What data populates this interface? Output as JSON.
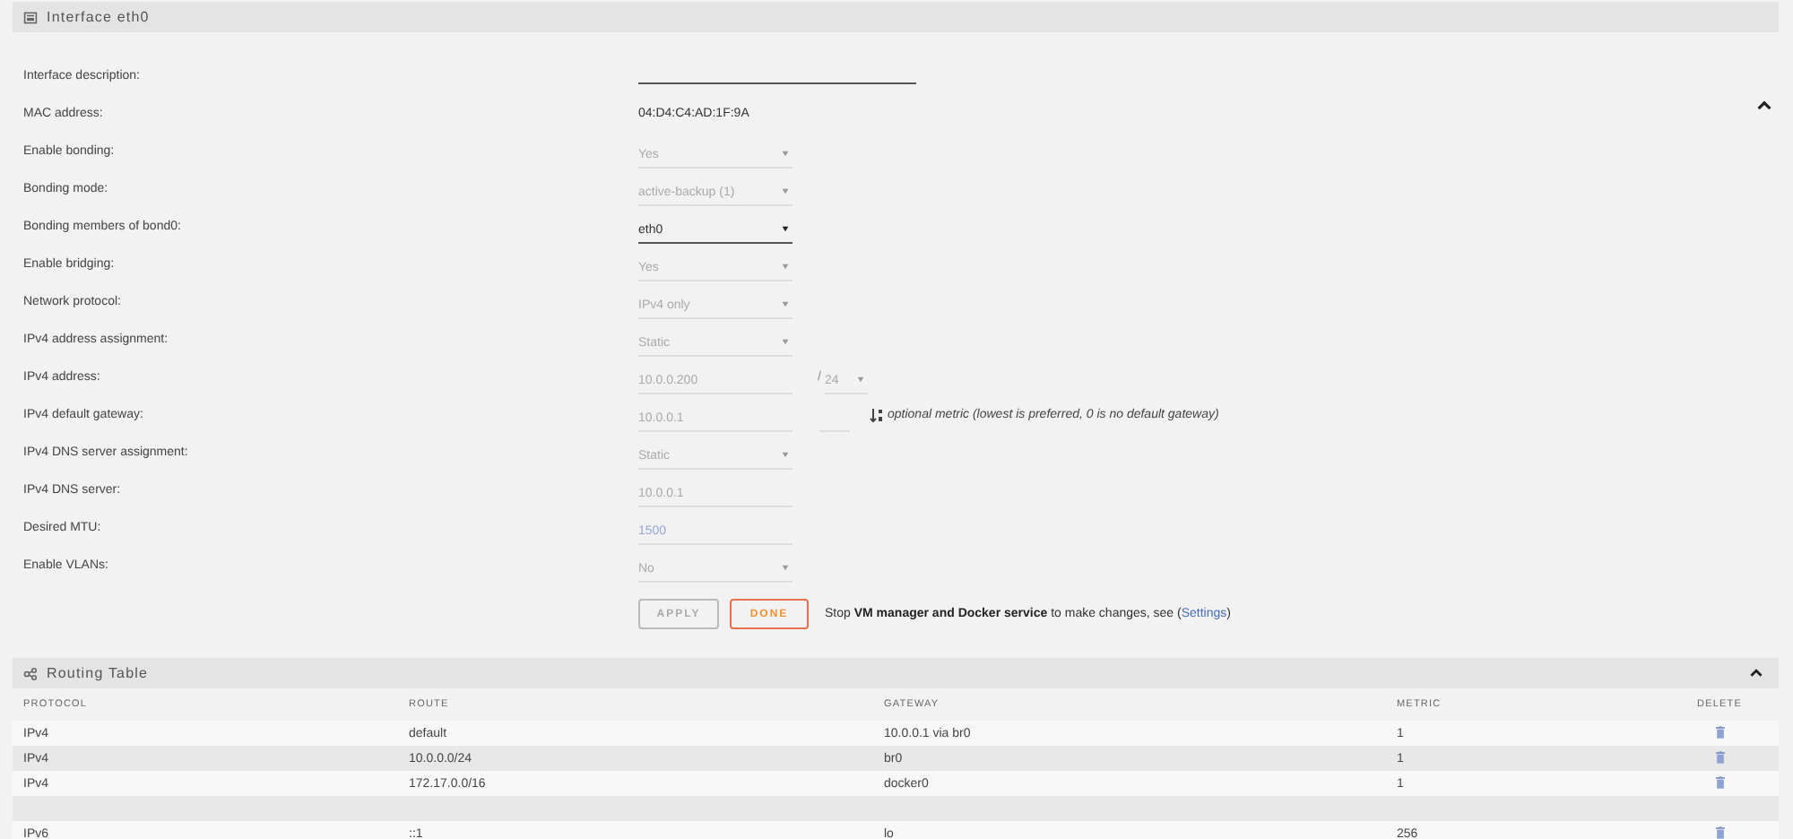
{
  "interface_panel": {
    "title": "Interface eth0",
    "expanded": true,
    "rows": [
      {
        "label": "Interface description:",
        "field": {
          "kind": "input",
          "disabled": false
        }
      },
      {
        "label": "MAC address:",
        "field": {
          "kind": "static",
          "value": "04:D4:C4:AD:1F:9A"
        }
      },
      {
        "label": "Enable bonding:",
        "field": {
          "kind": "select",
          "value": "Yes",
          "disabled": true
        }
      },
      {
        "label": "Bonding mode:",
        "field": {
          "kind": "select",
          "value": "active-backup (1)",
          "disabled": true
        }
      },
      {
        "label": "Bonding members of bond0:",
        "field": {
          "kind": "select",
          "value": "eth0",
          "disabled": false
        }
      },
      {
        "label": "Enable bridging:",
        "field": {
          "kind": "select",
          "value": "Yes",
          "disabled": true
        }
      },
      {
        "label": "Network protocol:",
        "field": {
          "kind": "select",
          "value": "IPv4 only",
          "disabled": true
        }
      },
      {
        "label": "IPv4 address assignment:",
        "field": {
          "kind": "select",
          "value": "Static",
          "disabled": true
        }
      },
      {
        "label": "IPv4 address:",
        "field": {
          "kind": "input",
          "value": "10.0.0.200",
          "disabled": true
        },
        "netmask": {
          "separator": "/",
          "value": "24"
        }
      },
      {
        "label": "IPv4 default gateway:",
        "field": {
          "kind": "input",
          "value": "10.0.0.1",
          "disabled": true
        },
        "metric": {
          "note": "optional metric (lowest is preferred, 0 is no default gateway)"
        }
      },
      {
        "label": "IPv4 DNS server assignment:",
        "field": {
          "kind": "select",
          "value": "Static",
          "disabled": true
        }
      },
      {
        "label": "IPv4 DNS server:",
        "field": {
          "kind": "input",
          "value": "10.0.0.1",
          "disabled": true
        }
      },
      {
        "label": "Desired MTU:",
        "field": {
          "kind": "input",
          "placeholder": "1500",
          "disabled": true
        }
      },
      {
        "label": "Enable VLANs:",
        "field": {
          "kind": "select",
          "value": "No",
          "disabled": true
        }
      }
    ],
    "buttons": [
      {
        "label": "APPLY",
        "disabled": true,
        "kind": "plain"
      },
      {
        "label": "DONE",
        "disabled": false,
        "kind": "accent"
      }
    ],
    "notice": {
      "text": "Stop **VM manager and Docker service** to make changes, see (",
      "link": "Settings",
      "end": ")"
    }
  },
  "routing_table": {
    "title": "Routing Table",
    "expanded": true,
    "columns": [
      "PROTOCOL",
      "ROUTE",
      "GATEWAY",
      "METRIC",
      "DELETE"
    ],
    "rows": [
      {
        "kind": "route",
        "protocol": "IPv4",
        "route": "default",
        "gateway": "10.0.0.1 via br0",
        "metric": "1"
      },
      {
        "kind": "route",
        "protocol": "IPv4",
        "route": "10.0.0.0/24",
        "gateway": "br0",
        "metric": "1"
      },
      {
        "kind": "route",
        "protocol": "IPv4",
        "route": "172.17.0.0/16",
        "gateway": "docker0",
        "metric": "1"
      },
      {
        "kind": "spacer"
      },
      {
        "kind": "route",
        "protocol": "IPv6",
        "route": "::1",
        "gateway": "lo",
        "metric": "256"
      }
    ]
  }
}
